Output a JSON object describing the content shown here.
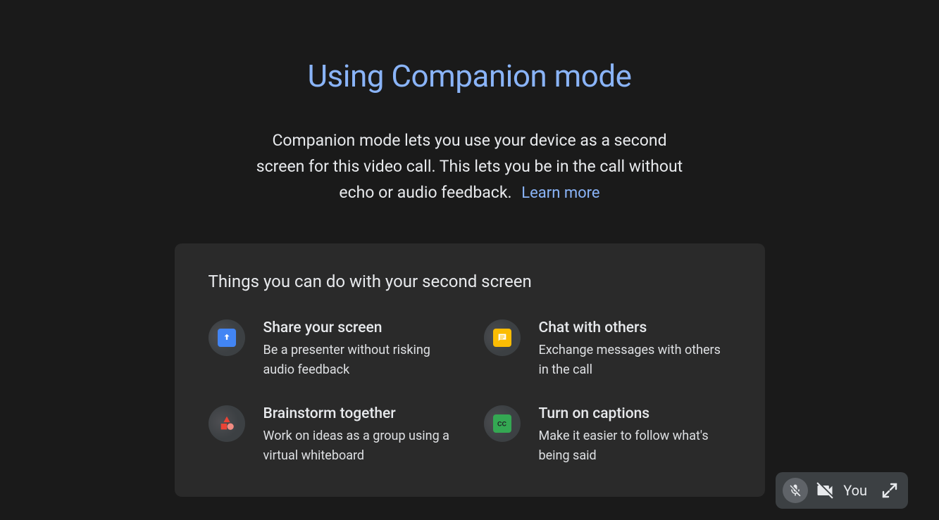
{
  "title": "Using Companion mode",
  "description": "Companion mode lets you use your device as a second screen for this video call. This lets you be in the call without echo or audio feedback.",
  "learnMore": "Learn more",
  "card": {
    "title": "Things you can do with your second screen",
    "features": [
      {
        "title": "Share your screen",
        "desc": "Be a presenter without risking audio feedback"
      },
      {
        "title": "Chat with others",
        "desc": "Exchange messages with others in the call"
      },
      {
        "title": "Brainstorm together",
        "desc": "Work on ideas as a group using a virtual whiteboard"
      },
      {
        "title": "Turn on captions",
        "desc": "Make it easier to follow what's being said"
      }
    ]
  },
  "selfView": {
    "label": "You"
  }
}
